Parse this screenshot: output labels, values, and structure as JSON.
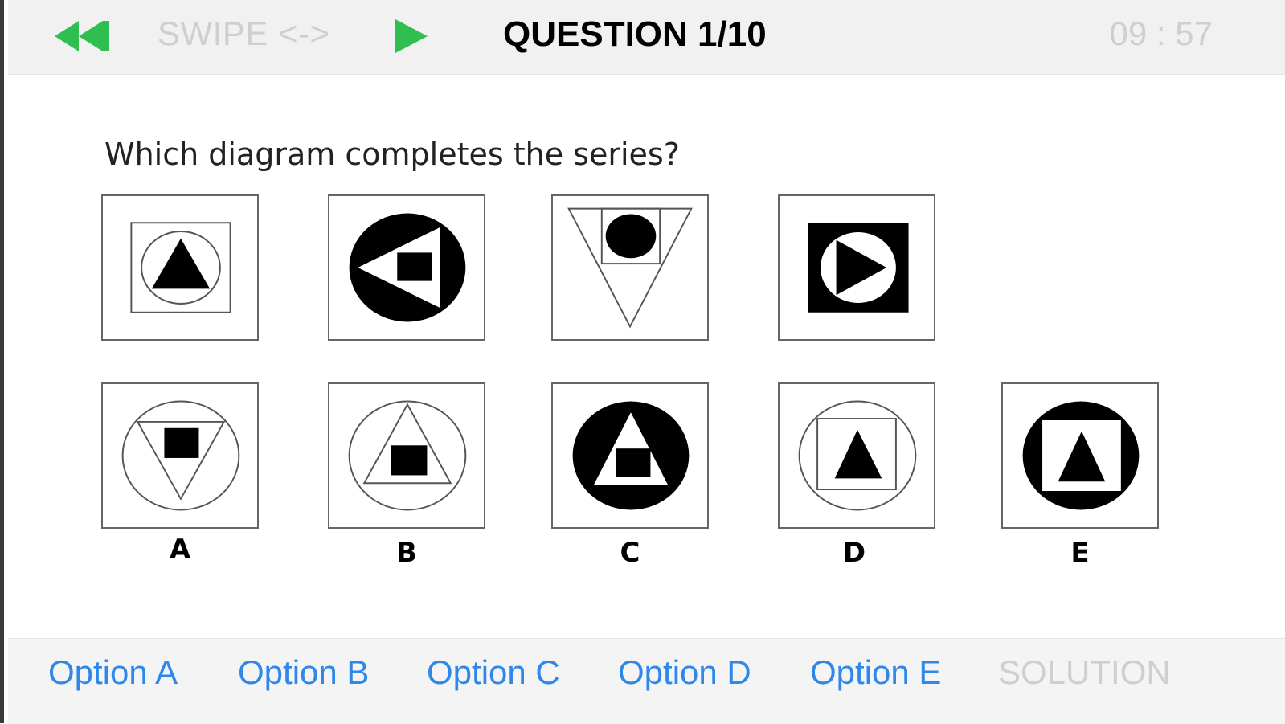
{
  "header": {
    "swipe_label": "SWIPE <->",
    "question_title": "QUESTION 1/10",
    "timer": "09 : 57",
    "accent_color": "#2fbe4f"
  },
  "question": {
    "prompt": "Which diagram completes the series?"
  },
  "series": [
    {
      "id": "series-1"
    },
    {
      "id": "series-2"
    },
    {
      "id": "series-3"
    },
    {
      "id": "series-4"
    }
  ],
  "answers": {
    "labels": [
      "A",
      "B",
      "C",
      "D",
      "E"
    ]
  },
  "footer": {
    "options": [
      "Option A",
      "Option B",
      "Option C",
      "Option D",
      "Option E"
    ],
    "solution": "SOLUTION",
    "option_color": "#2f87e8"
  }
}
